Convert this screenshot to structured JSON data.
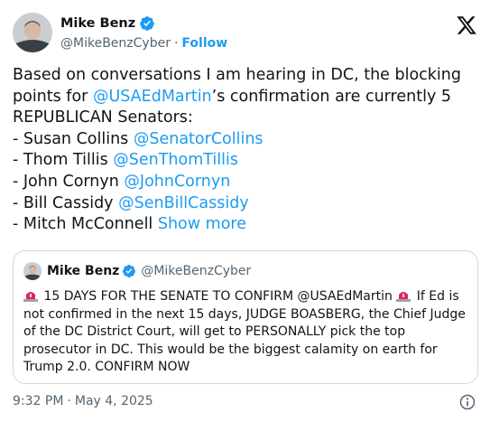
{
  "author": {
    "name": "Mike Benz",
    "handle": "@MikeBenzCyber",
    "separator": "·",
    "follow_label": "Follow",
    "avatar_icon": "avatar-photo",
    "verified_icon": "verified-badge-icon",
    "verified_color": "#1d9bf0"
  },
  "platform_icon": "x-logo-icon",
  "tweet": {
    "line1": "Based on conversations I am hearing in DC, the blocking",
    "line2_pre": "points for ",
    "line2_mention": "@USAEdMartin",
    "line2_post": "’s confirmation are currently 5",
    "line3": "REPUBLICAN Senators:",
    "senators": [
      {
        "prefix": "- Susan Collins ",
        "mention": "@SenatorCollins"
      },
      {
        "prefix": "- Thom Tillis ",
        "mention": "@SenThomTillis"
      },
      {
        "prefix": "- John Cornyn ",
        "mention": "@JohnCornyn"
      },
      {
        "prefix": "- Bill Cassidy ",
        "mention": "@SenBillCassidy"
      }
    ],
    "last_line": "- Mitch McConnell ",
    "show_more": "Show more"
  },
  "quote": {
    "name": "Mike Benz",
    "handle": "@MikeBenzCyber",
    "siren_icon": "police-siren-emoji",
    "text_part1": " 15 DAYS FOR THE SENATE TO CONFIRM @USAEdMartin ",
    "text_part2": " If Ed is not confirmed in the next 15 days, JUDGE BOASBERG, the Chief Judge of the DC District Court, will get to PERSONALLY pick the top prosecutor in DC. This would be the biggest calamity on earth for Trump 2.0. CONFIRM NOW"
  },
  "footer": {
    "time": "9:32 PM",
    "separator": "·",
    "date": "May 4, 2025",
    "info_icon": "info-icon"
  },
  "colors": {
    "link": "#1d9bf0",
    "secondary_text": "#536471",
    "border": "#cfd9de",
    "siren_red": "#e0245e"
  }
}
